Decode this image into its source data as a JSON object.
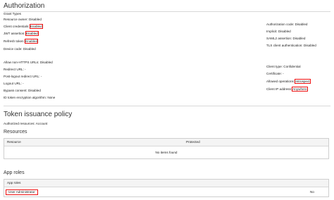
{
  "authorization": {
    "title": "Authorization",
    "grant_types_label": "Grant Types",
    "left": [
      {
        "label": "Resource owner:",
        "value": "Disabled"
      },
      {
        "label": "Client credentials:",
        "value": "Enabled"
      },
      {
        "label": "JWT assertion:",
        "value": "Enabled"
      },
      {
        "label": "Refresh token:",
        "value": "Enabled"
      },
      {
        "label": "Device code:",
        "value": "Disabled"
      }
    ],
    "right": [
      {
        "label": "Authorization code:",
        "value": "Disabled"
      },
      {
        "label": "Implicit:",
        "value": "Disabled"
      },
      {
        "label": "SAML2 assertion:",
        "value": "Disabled"
      },
      {
        "label": "TLS client authentication:",
        "value": "Disabled"
      }
    ],
    "left2": [
      {
        "label": "Allow non-HTTPS URLs:",
        "value": "Disabled"
      },
      {
        "label": "Redirect URL:",
        "value": "-"
      },
      {
        "label": "Post-logout redirect URL:",
        "value": "-"
      },
      {
        "label": "Logout URL:",
        "value": "-"
      },
      {
        "label": "Bypass consent:",
        "value": "Disabled"
      },
      {
        "label": "ID token encryption algorithm:",
        "value": "None"
      }
    ],
    "right2": [
      {
        "label": "Client type:",
        "value": "Confidential"
      },
      {
        "label": "Certificate:",
        "value": "-"
      },
      {
        "label": "Allowed operations:",
        "value": "Introspect"
      },
      {
        "label": "Client IP address:",
        "value": "Anywhere"
      }
    ]
  },
  "token_policy": {
    "title": "Token issuance policy",
    "authorized_label": "Authorized resources:",
    "authorized_value": "Account"
  },
  "resources": {
    "title": "Resources",
    "columns": [
      "Resource",
      "Protected"
    ],
    "empty": "No items found"
  },
  "app_roles": {
    "title": "App roles",
    "columns": [
      "App roles"
    ],
    "rows": [
      {
        "name": "User Administrator",
        "value": "No"
      }
    ]
  },
  "colors": {
    "highlight": "#e11111",
    "header_bg": "#f4f4f4",
    "rule": "#d8d8d8"
  }
}
